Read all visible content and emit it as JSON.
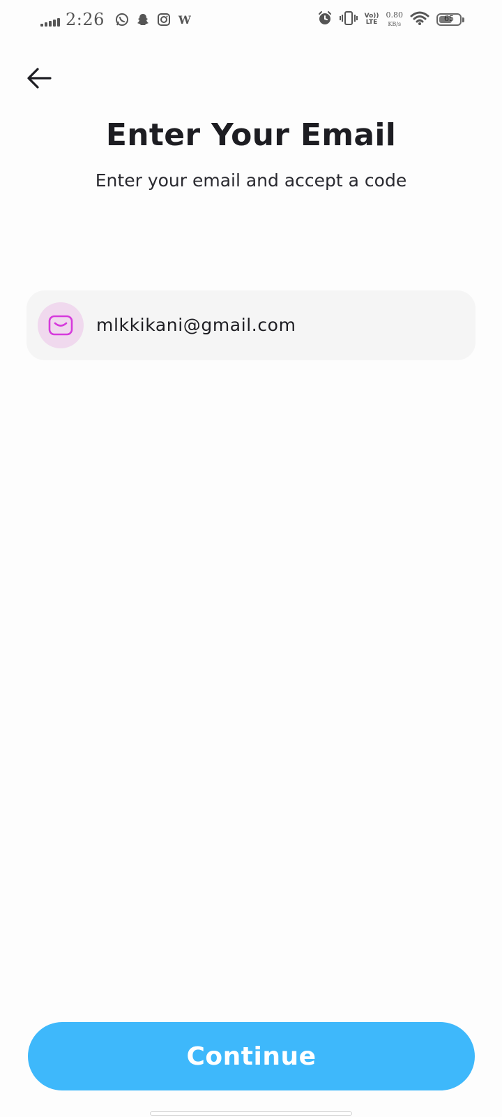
{
  "status_bar": {
    "time": "2:26",
    "apps": [
      "whatsapp-icon",
      "snapchat-icon",
      "instagram-icon",
      "wikipedia-icon"
    ],
    "wiki_glyph": "W",
    "volte_line1": "Vo))",
    "volte_line2": "LTE",
    "net_speed": "0.80",
    "net_speed_unit": "KB/s",
    "battery_level": "65",
    "battery_fraction": 0.65
  },
  "header": {
    "back_icon": "arrow-left-icon",
    "title": "Enter Your Email",
    "subtitle": "Enter your email and accept a code"
  },
  "email_field": {
    "icon": "mail-icon",
    "value": "mlkkikani@gmail.com"
  },
  "footer": {
    "continue_label": "Continue"
  },
  "colors": {
    "background": "#fdfdfd",
    "accent": "#3eb8fb",
    "field_background": "#f5f5f5",
    "icon_circle": "#f0d9ee",
    "icon_stroke": "#d63bdc",
    "text": "#1d1d22"
  }
}
